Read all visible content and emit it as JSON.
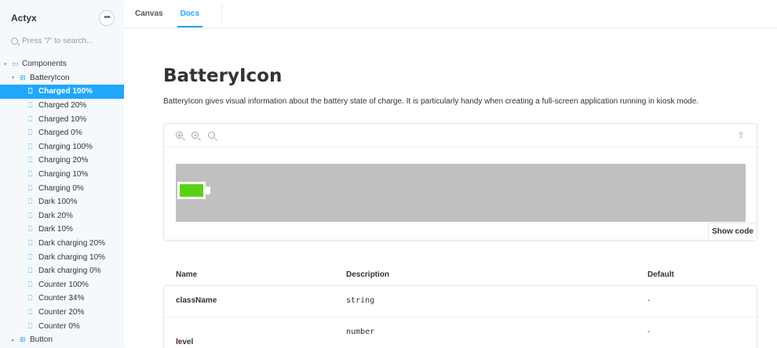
{
  "sidebar": {
    "brand": "Actyx",
    "menu_icon": "ellipsis-icon",
    "search_placeholder": "Press \"/\" to search...",
    "tree": [
      {
        "label": "Components",
        "kind": "folder",
        "level": 0,
        "expanded": true
      },
      {
        "label": "BatteryIcon",
        "kind": "component",
        "level": 1,
        "expanded": true
      },
      {
        "label": "Charged 100%",
        "kind": "story",
        "level": 2,
        "selected": true
      },
      {
        "label": "Charged 20%",
        "kind": "story",
        "level": 2
      },
      {
        "label": "Charged 10%",
        "kind": "story",
        "level": 2
      },
      {
        "label": "Charged 0%",
        "kind": "story",
        "level": 2
      },
      {
        "label": "Charging 100%",
        "kind": "story",
        "level": 2
      },
      {
        "label": "Charging 20%",
        "kind": "story",
        "level": 2
      },
      {
        "label": "Charging 10%",
        "kind": "story",
        "level": 2
      },
      {
        "label": "Charging 0%",
        "kind": "story",
        "level": 2
      },
      {
        "label": "Dark 100%",
        "kind": "story",
        "level": 2
      },
      {
        "label": "Dark 20%",
        "kind": "story",
        "level": 2
      },
      {
        "label": "Dark 10%",
        "kind": "story",
        "level": 2
      },
      {
        "label": "Dark charging 20%",
        "kind": "story",
        "level": 2
      },
      {
        "label": "Dark charging 10%",
        "kind": "story",
        "level": 2
      },
      {
        "label": "Dark charging 0%",
        "kind": "story",
        "level": 2
      },
      {
        "label": "Counter 100%",
        "kind": "story",
        "level": 2
      },
      {
        "label": "Counter 34%",
        "kind": "story",
        "level": 2
      },
      {
        "label": "Counter 20%",
        "kind": "story",
        "level": 2
      },
      {
        "label": "Counter 0%",
        "kind": "story",
        "level": 2
      },
      {
        "label": "Button",
        "kind": "component",
        "level": 1,
        "expanded": false
      }
    ]
  },
  "tabs": {
    "canvas": "Canvas",
    "docs": "Docs",
    "active": "Docs"
  },
  "doc": {
    "title": "BatteryIcon",
    "description": "BatteryIcon gives visual information about the battery state of charge. It is particularly handy when creating a full-screen application running in kiosk mode."
  },
  "preview": {
    "tools": [
      "zoom-in-icon",
      "zoom-out-icon",
      "reset-zoom-icon",
      "share-icon"
    ],
    "battery_level_percent": 100,
    "battery_fill_color": "#5ad214",
    "canvas_background": "#c0c0c0",
    "show_code_label": "Show code"
  },
  "props": {
    "headers": {
      "name": "Name",
      "description": "Description",
      "default": "Default"
    },
    "rows": [
      {
        "name": "className",
        "required": false,
        "type": "string",
        "default": "-"
      },
      {
        "name": "level",
        "required": true,
        "required_mark": "*",
        "type": "number",
        "default": "-"
      }
    ]
  },
  "colors": {
    "accent": "#1ea7fd",
    "required": "#ff4400"
  }
}
